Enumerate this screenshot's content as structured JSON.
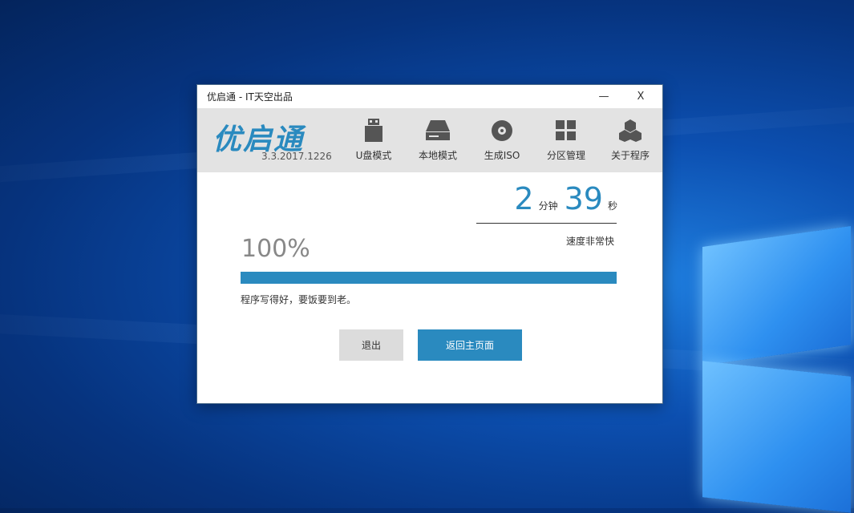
{
  "window": {
    "title": "优启通 - IT天空出品",
    "minimize_label": "—",
    "close_label": "X"
  },
  "header": {
    "logo_text": "优启通",
    "version": "3.3.2017.1226",
    "nav": [
      {
        "label": "U盘模式",
        "icon": "usb-drive-icon"
      },
      {
        "label": "本地模式",
        "icon": "hard-drive-icon"
      },
      {
        "label": "生成ISO",
        "icon": "disc-icon"
      },
      {
        "label": "分区管理",
        "icon": "partition-grid-icon"
      },
      {
        "label": "关于程序",
        "icon": "cubes-icon"
      }
    ]
  },
  "timer": {
    "minutes": "2",
    "minutes_unit": "分钟",
    "seconds": "39",
    "seconds_unit": "秒",
    "speed_text": "速度非常快"
  },
  "progress": {
    "percent_text": "100%",
    "value": 1.0,
    "status_text": "程序写得好，要饭要到老。"
  },
  "buttons": {
    "exit_label": "退出",
    "home_label": "返回主页面"
  },
  "colors": {
    "accent": "#2a8abf",
    "header_bg": "#e3e3e3"
  }
}
